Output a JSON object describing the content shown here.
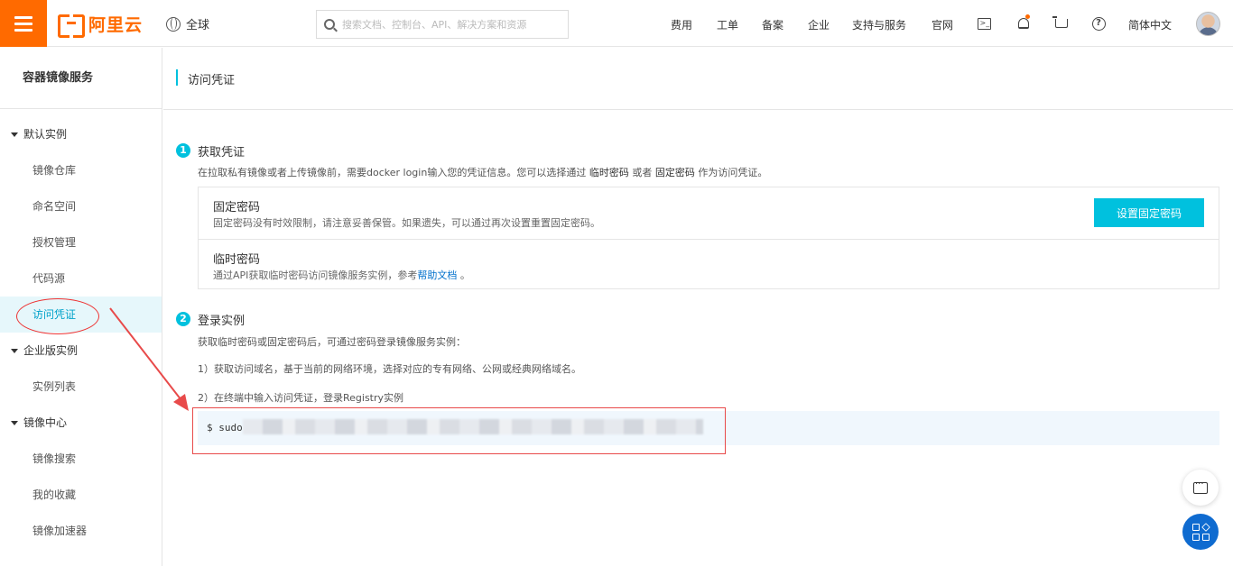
{
  "topbar": {
    "logo_text": "阿里云",
    "region": "全球",
    "search_placeholder": "搜索文档、控制台、API、解决方案和资源",
    "nav": [
      "费用",
      "工单",
      "备案",
      "企业",
      "支持与服务",
      "官网"
    ],
    "language": "简体中文",
    "icons": [
      "terminal-icon",
      "bell-icon",
      "cart-icon",
      "help-icon"
    ]
  },
  "sidebar": {
    "title": "容器镜像服务",
    "groups": [
      {
        "label": "默认实例",
        "items": [
          "镜像仓库",
          "命名空间",
          "授权管理",
          "代码源",
          "访问凭证"
        ]
      },
      {
        "label": "企业版实例",
        "items": [
          "实例列表"
        ]
      },
      {
        "label": "镜像中心",
        "items": [
          "镜像搜索",
          "我的收藏",
          "镜像加速器"
        ]
      }
    ],
    "active_item": "访问凭证"
  },
  "page": {
    "title": "访问凭证",
    "step1": {
      "num": "1",
      "title": "获取凭证",
      "desc_pre": "在拉取私有镜像或者上传镜像前，需要docker login输入您的凭证信息。您可以选择通过 ",
      "desc_temp": "临时密码",
      "desc_mid": " 或者 ",
      "desc_fixed": "固定密码",
      "desc_post": " 作为访问凭证。",
      "fixed": {
        "name": "固定密码",
        "desc": "固定密码没有时效限制，请注意妥善保管。如果遗失，可以通过再次设置重置固定密码。",
        "button": "设置固定密码"
      },
      "temp": {
        "name": "临时密码",
        "desc_pre": "通过API获取临时密码访问镜像服务实例，参考",
        "link": "帮助文档",
        "desc_post": " 。"
      }
    },
    "step2": {
      "num": "2",
      "title": "登录实例",
      "desc": "获取临时密码或固定密码后，可通过密码登录镜像服务实例：",
      "line1": "1）获取访问域名，基于当前的网络环境，选择对应的专有网络、公网或经典网络域名。",
      "line2": "2）在终端中输入访问凭证，登录Registry实例",
      "code": "$ sudo"
    }
  },
  "colors": {
    "brand": "#ff6a00",
    "accent": "#00c1de",
    "link": "#0070cc",
    "annotation": "#e84a4a"
  }
}
